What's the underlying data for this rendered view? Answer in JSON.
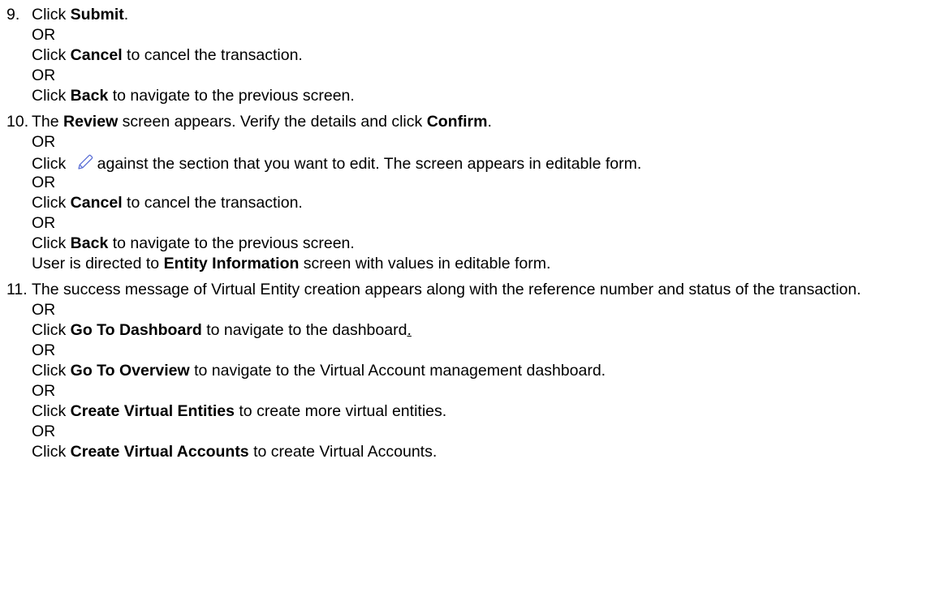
{
  "steps": [
    {
      "number": "9.",
      "lines": [
        {
          "parts": [
            {
              "t": "Click "
            },
            {
              "t": "Submit",
              "b": true
            },
            {
              "t": "."
            }
          ]
        },
        {
          "parts": [
            {
              "t": "OR"
            }
          ]
        },
        {
          "parts": [
            {
              "t": "Click "
            },
            {
              "t": "Cancel",
              "b": true
            },
            {
              "t": " to cancel the transaction."
            }
          ]
        },
        {
          "parts": [
            {
              "t": "OR"
            }
          ]
        },
        {
          "parts": [
            {
              "t": "Click "
            },
            {
              "t": "Back",
              "b": true
            },
            {
              "t": " to navigate to the previous screen."
            }
          ]
        }
      ]
    },
    {
      "number": "10.",
      "lines": [
        {
          "parts": [
            {
              "t": "The "
            },
            {
              "t": "Review",
              "b": true
            },
            {
              "t": " screen appears. Verify the details and click "
            },
            {
              "t": "Confirm",
              "b": true
            },
            {
              "t": "."
            }
          ]
        },
        {
          "parts": [
            {
              "t": "OR"
            }
          ]
        },
        {
          "parts": [
            {
              "t": "Click "
            },
            {
              "icon": "pencil-edit-icon"
            },
            {
              "t": "against the section that you want to edit. The screen appears in editable form."
            }
          ]
        },
        {
          "parts": [
            {
              "t": "OR"
            }
          ]
        },
        {
          "parts": [
            {
              "t": "Click "
            },
            {
              "t": "Cancel",
              "b": true
            },
            {
              "t": " to cancel the transaction."
            }
          ]
        },
        {
          "parts": [
            {
              "t": "OR"
            }
          ]
        },
        {
          "parts": [
            {
              "t": "Click "
            },
            {
              "t": "Back",
              "b": true
            },
            {
              "t": " to navigate to the previous screen."
            }
          ]
        },
        {
          "parts": [
            {
              "t": "User is directed to "
            },
            {
              "t": "Entity Information",
              "b": true
            },
            {
              "t": " screen with values in editable form."
            }
          ]
        }
      ]
    },
    {
      "number": "11.",
      "lines": [
        {
          "wrap": true,
          "parts": [
            {
              "t": "The success message of Virtual Entity creation appears along with the reference number and status of the transaction."
            }
          ]
        },
        {
          "parts": [
            {
              "t": "OR"
            }
          ]
        },
        {
          "parts": [
            {
              "t": "Click "
            },
            {
              "t": "Go To Dashboard",
              "b": true
            },
            {
              "t": " to navigate to the dashboard"
            },
            {
              "t": ".",
              "u": true
            }
          ]
        },
        {
          "parts": [
            {
              "t": "OR"
            }
          ]
        },
        {
          "parts": [
            {
              "t": "Click "
            },
            {
              "t": "Go To Overview",
              "b": true
            },
            {
              "t": " to navigate to the Virtual Account management dashboard."
            }
          ]
        },
        {
          "parts": [
            {
              "t": "OR"
            }
          ]
        },
        {
          "parts": [
            {
              "t": "Click "
            },
            {
              "t": "Create Virtual Entities",
              "b": true
            },
            {
              "t": " to create more virtual entities."
            }
          ]
        },
        {
          "parts": [
            {
              "t": "OR"
            }
          ]
        },
        {
          "parts": [
            {
              "t": "Click "
            },
            {
              "t": "Create Virtual Accounts",
              "b": true
            },
            {
              "t": " to create Virtual Accounts."
            }
          ]
        }
      ]
    }
  ]
}
